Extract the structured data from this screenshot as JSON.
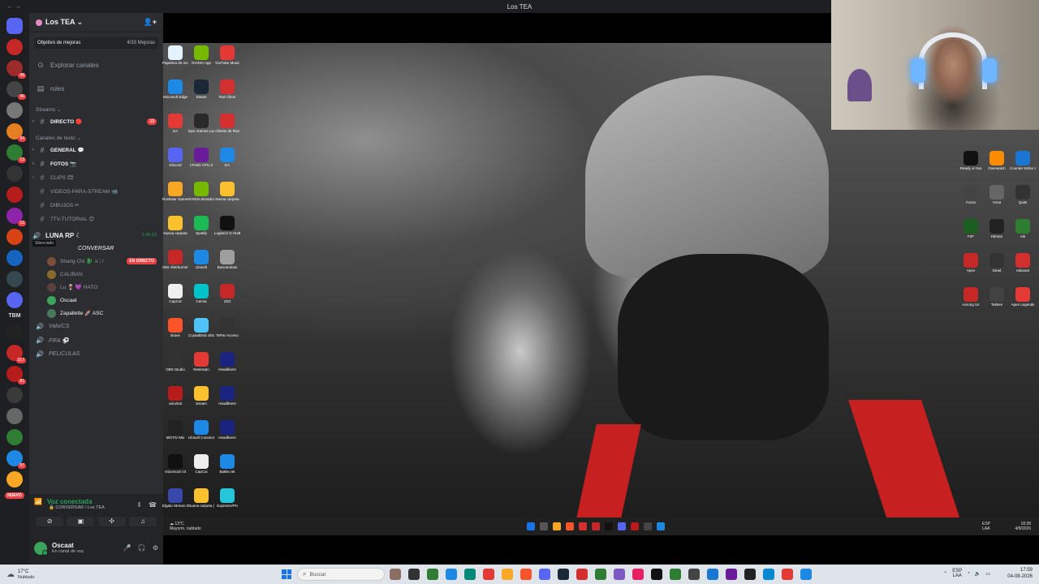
{
  "window": {
    "title": "Los TEA"
  },
  "server": {
    "name": "Los TEA",
    "boost_label": "Objetivo de mejoras",
    "boost_count": "4/33 Mejoras"
  },
  "nav": {
    "explore": "Explorar canales",
    "rules": "rules"
  },
  "categories": {
    "streams": "Streams",
    "text": "Canales de texto"
  },
  "channels": {
    "directo": "DIRECTO 🔴",
    "directo_badge": "13",
    "general": "GENERAL 💬",
    "fotos": "FOTOS 📷",
    "clips": "CLIPS 🎞",
    "videos": "VIDEOS-PARA-STREAM 📹",
    "dibujos": "DIBUJOS ✏",
    "tutorial": "7TV-TUTORIAL 😊"
  },
  "voice": {
    "channel": "LUNA RP ☾",
    "silenced": "Silenciado",
    "timer": "1:49:13",
    "sub_channel": "CONVERSAR",
    "users": [
      {
        "name": "Shang Chi 🐉 ⚔ᛁ/",
        "live": "EN DIRECTO",
        "color": "#7a4e3a"
      },
      {
        "name": "CALIBAN",
        "color": "#8a6a2e"
      },
      {
        "name": "Lu 🍷 💜 HATO",
        "color": "#5c4040"
      },
      {
        "name": "Oscaat",
        "color": "#3ba55c"
      },
      {
        "name": "Zapallette 🚀 ASC",
        "color": "#4a7a5a"
      }
    ],
    "other_channels": [
      "Valo/CS",
      "FIFA ⚽",
      "PELICULAS"
    ]
  },
  "voice_panel": {
    "status": "Voz conectada",
    "location": "🔒 CONVERSAR / Los TEA"
  },
  "user": {
    "name": "Oscaat",
    "status": "En canal de voz"
  },
  "rail": {
    "servers": [
      {
        "color": "#5865f2",
        "badge": ""
      },
      {
        "color": "#c62828",
        "badge": ""
      },
      {
        "color": "#9c2b2b",
        "badge": "48"
      },
      {
        "color": "#444",
        "badge": "46"
      },
      {
        "color": "#777",
        "badge": ""
      },
      {
        "color": "#e67e22",
        "badge": "94"
      },
      {
        "color": "#2e7d32",
        "badge": "13"
      },
      {
        "color": "#333",
        "badge": ""
      },
      {
        "color": "#b71c1c",
        "badge": ""
      },
      {
        "color": "#8e24aa",
        "badge": "13"
      },
      {
        "color": "#d84315",
        "badge": ""
      },
      {
        "color": "#1565c0",
        "badge": ""
      },
      {
        "color": "#37474f",
        "badge": ""
      },
      {
        "color": "#5865f2",
        "badge": ""
      },
      {
        "color": "#222",
        "badge": ""
      },
      {
        "color": "#c62828",
        "badge": "217"
      },
      {
        "color": "#b71c1c",
        "badge": "81"
      },
      {
        "color": "#3a3a3a",
        "badge": ""
      },
      {
        "color": "#666",
        "badge": ""
      },
      {
        "color": "#2e7d32",
        "badge": ""
      },
      {
        "color": "#1e88e5",
        "badge": "97"
      },
      {
        "color": "#f9a825",
        "badge": ""
      }
    ],
    "tbm": "TBM",
    "new_label": "NUEVO"
  },
  "desktop_icons_left": [
    {
      "label": "Papelera de reciclaje",
      "color": "#e3f2fd"
    },
    {
      "label": "Microsoft Edge",
      "color": "#1e88e5"
    },
    {
      "label": "EA",
      "color": "#e53935"
    },
    {
      "label": "Discord",
      "color": "#5865f2"
    },
    {
      "label": "Rockstar Games",
      "color": "#f9a825"
    },
    {
      "label": "Nueva carpeta",
      "color": "#fbc02d"
    },
    {
      "label": "MSI Afterburner",
      "color": "#c62828"
    },
    {
      "label": "CapCut",
      "color": "#eee"
    },
    {
      "label": "Brave",
      "color": "#fb542b"
    },
    {
      "label": "OBS Studio",
      "color": "#333"
    },
    {
      "label": "voicebot",
      "color": "#b71c1c"
    },
    {
      "label": "MOTIV Mix",
      "color": "#222"
    },
    {
      "label": "Voicemod V3",
      "color": "#111"
    },
    {
      "label": "Elgato Stream Deck",
      "color": "#3949ab"
    }
  ],
  "desktop_icons_mid": [
    {
      "label": "NVIDIA App",
      "color": "#76b900"
    },
    {
      "label": "Steam",
      "color": "#1b2838"
    },
    {
      "label": "Epic Games Launcher",
      "color": "#2a2a2a"
    },
    {
      "label": "CPUID CPU-Z",
      "color": "#6a1b9a"
    },
    {
      "label": "NVIDIA Broadcast",
      "color": "#76b900"
    },
    {
      "label": "Spotify",
      "color": "#1db954"
    },
    {
      "label": "Ubisoft",
      "color": "#1e88e5"
    },
    {
      "label": "Canva",
      "color": "#00c4cc"
    },
    {
      "label": "CrystalDisk Shizuku",
      "color": "#4fc3f7"
    },
    {
      "label": "Restream",
      "color": "#e53935"
    },
    {
      "label": "stream",
      "color": "#fbc02d"
    },
    {
      "label": "Ubisoft Connect",
      "color": "#1e88e5"
    },
    {
      "label": "CapCut",
      "color": "#eee"
    },
    {
      "label": "Nueva carpeta (2)",
      "color": "#fbc02d"
    }
  ],
  "desktop_icons_mid2": [
    {
      "label": "YouTube Music",
      "color": "#e53935"
    },
    {
      "label": "Riot Client",
      "color": "#d32f2f"
    },
    {
      "label": "Cliente de Riot",
      "color": "#d32f2f"
    },
    {
      "label": "EA",
      "color": "#1e88e5"
    },
    {
      "label": "Nueva carpeta",
      "color": "#fbc02d"
    },
    {
      "label": "Logitech G HUB",
      "color": "#111"
    },
    {
      "label": "Buscaminas",
      "color": "#9e9e9e"
    },
    {
      "label": "ZZZ",
      "color": "#c62828"
    },
    {
      "label": "TePar Acceso",
      "color": "#333"
    },
    {
      "label": "Headliners",
      "color": "#1a237e"
    },
    {
      "label": "Headliners",
      "color": "#1a237e"
    },
    {
      "label": "Headliners",
      "color": "#1a237e"
    },
    {
      "label": "Battle.net",
      "color": "#1e88e5"
    },
    {
      "label": "ExpressVPN",
      "color": "#26c6da"
    }
  ],
  "desktop_icons_right": [
    {
      "label": "Ready or Not",
      "color": "#111"
    },
    {
      "label": "Overwatch",
      "color": "#fb8c00"
    },
    {
      "label": "Counter-Strike 2",
      "color": "#1976d2"
    },
    {
      "label": "Forza",
      "color": "#444"
    },
    {
      "label": "Arma",
      "color": "#666"
    },
    {
      "label": "Quiet",
      "color": "#333"
    },
    {
      "label": "F2F",
      "color": "#1b5e20"
    },
    {
      "label": "Hitman",
      "color": "#222"
    },
    {
      "label": "Ark",
      "color": "#2e7d32"
    },
    {
      "label": "Apex",
      "color": "#c62828"
    },
    {
      "label": "Dead",
      "color": "#333"
    },
    {
      "label": "Valorant",
      "color": "#d32f2f"
    },
    {
      "label": "Among Us",
      "color": "#c62828"
    },
    {
      "label": "Tekken",
      "color": "#424242"
    },
    {
      "label": "Apex Legends",
      "color": "#e53935"
    }
  ],
  "inner_taskbar": {
    "weather_temp": "13°C",
    "weather_desc": "Mayorm. nublado",
    "lang": "ESP\nLAA",
    "time": "18:38",
    "date": "4/8/2026"
  },
  "taskbar": {
    "weather_temp": "17°C",
    "weather_desc": "Nublado",
    "search_placeholder": "Buscar",
    "lang1": "ESP",
    "lang2": "LAA",
    "time": "17:59",
    "date": "04-08-2026"
  }
}
